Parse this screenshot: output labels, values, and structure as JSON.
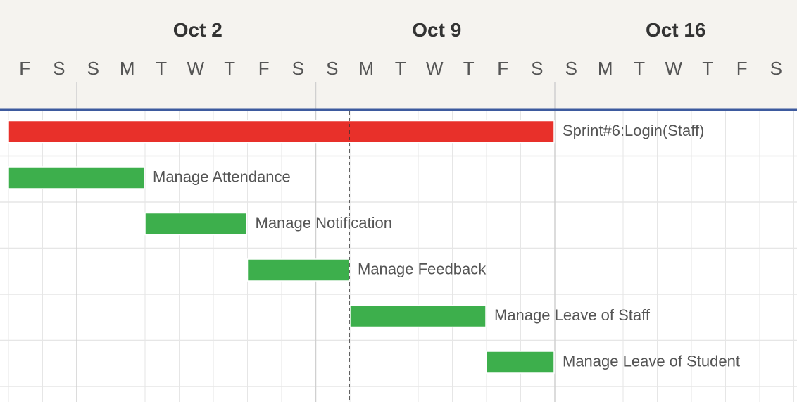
{
  "chart_data": {
    "type": "gantt",
    "week_labels": [
      "Oct 2",
      "Oct 9",
      "Oct 16"
    ],
    "day_labels": [
      "F",
      "S",
      "S",
      "M",
      "T",
      "W",
      "T",
      "F",
      "S",
      "S",
      "M",
      "T",
      "W",
      "T",
      "F",
      "S",
      "S",
      "M",
      "T",
      "W",
      "T",
      "F",
      "S"
    ],
    "tasks": [
      {
        "label": "Sprint#6:Login(Staff)",
        "start": "Sep 29",
        "end": "Oct 14",
        "color": "#e8302a"
      },
      {
        "label": "Manage Attendance",
        "start": "Sep 29",
        "end": "Oct 2",
        "color": "#3daf4c"
      },
      {
        "label": "Manage Notification",
        "start": "Oct 3",
        "end": "Oct 5",
        "color": "#3daf4c"
      },
      {
        "label": "Manage Feedback",
        "start": "Oct 6",
        "end": "Oct 8",
        "color": "#3daf4c"
      },
      {
        "label": "Manage Leave of Staff",
        "start": "Oct 9",
        "end": "Oct 12",
        "color": "#3daf4c"
      },
      {
        "label": "Manage Leave of Student",
        "start": "Oct 13",
        "end": "Oct 14",
        "color": "#3daf4c"
      }
    ],
    "today_marker": "Oct 9",
    "grid": true,
    "colors": {
      "header_background": "#f5f3ef",
      "header_rule": "#3d5a9e",
      "grid_line": "#e6e6e6",
      "week_divider": "#d0d0d0",
      "today_line": "#333333",
      "week_text": "#333333",
      "day_text": "#555555",
      "task_text": "#555555"
    }
  }
}
